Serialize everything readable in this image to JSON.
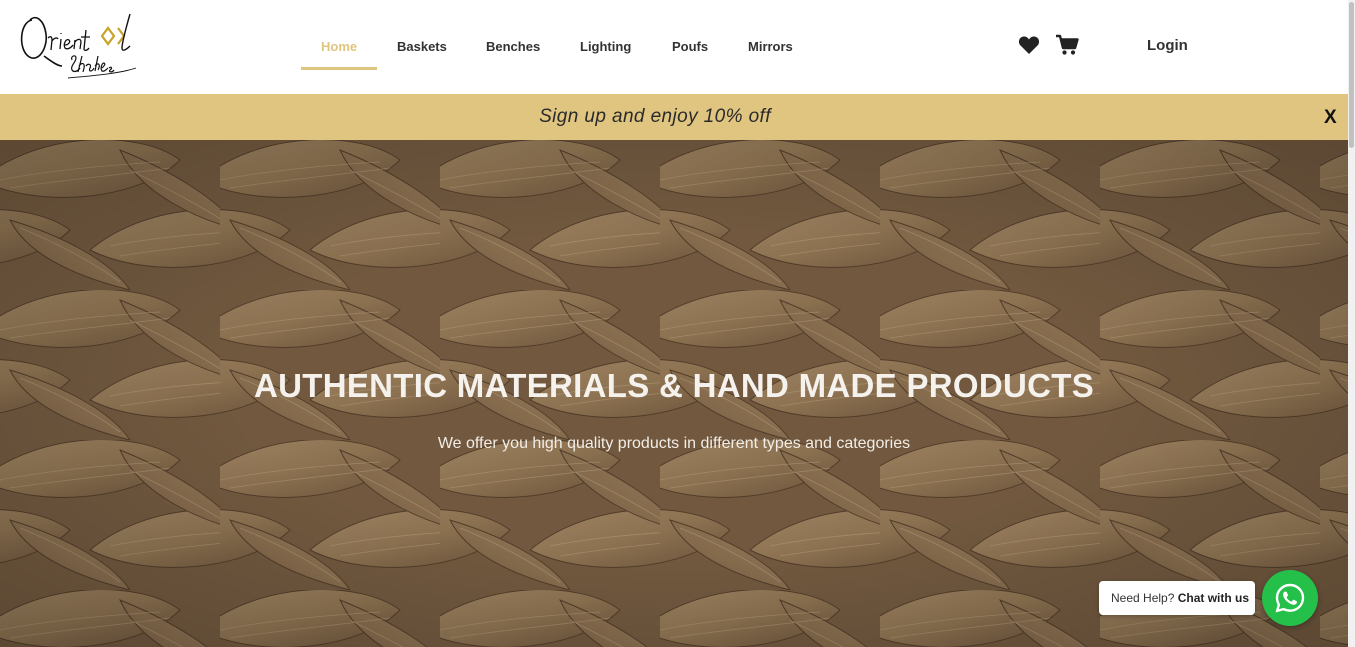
{
  "logo": {
    "text_main": "Oriental",
    "text_sub": "Shades",
    "icon": "oriental-shades-logo"
  },
  "nav": {
    "items": [
      {
        "label": "Home",
        "active": true
      },
      {
        "label": "Baskets",
        "active": false
      },
      {
        "label": "Benches",
        "active": false
      },
      {
        "label": "Lighting",
        "active": false
      },
      {
        "label": "Poufs",
        "active": false
      },
      {
        "label": "Mirrors",
        "active": false
      }
    ]
  },
  "header": {
    "wishlist_icon": "heart-icon",
    "cart_icon": "cart-icon",
    "login_label": "Login"
  },
  "promo": {
    "text": "Sign up and enjoy 10% off",
    "close_label": "X"
  },
  "hero": {
    "title": "AUTHENTIC MATERIALS & HAND MADE PRODUCTS",
    "subtitle": "We offer you high quality products in different types and categories"
  },
  "chat": {
    "prefix": "Need Help?",
    "link": "Chat with us",
    "icon": "whatsapp-icon"
  },
  "colors": {
    "accent": "#e0c57f",
    "promo_bg": "#e0c580",
    "whatsapp": "#25c04a",
    "text_dark": "#333333"
  }
}
